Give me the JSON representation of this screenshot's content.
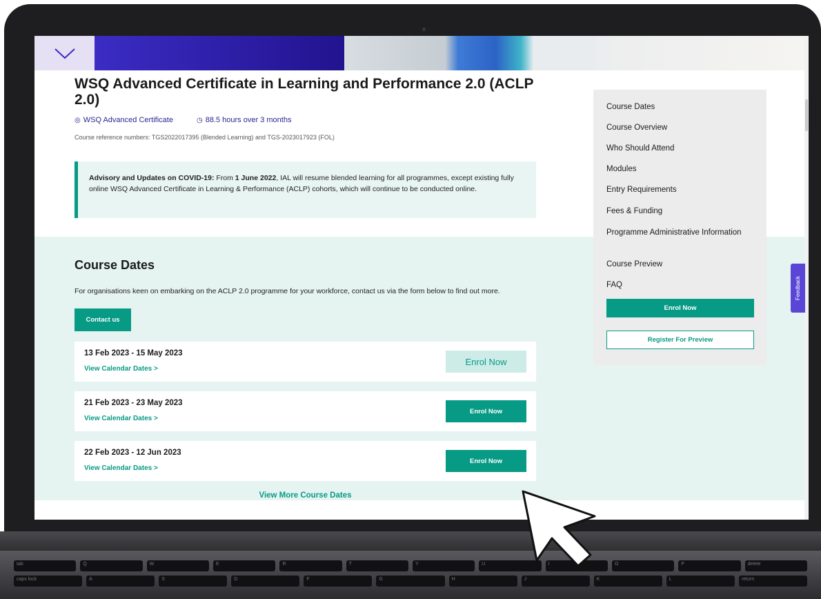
{
  "page": {
    "title": "WSQ Advanced Certificate in Learning and Performance 2.0 (ACLP 2.0)",
    "certificate_type": "WSQ Advanced Certificate",
    "duration": "88.5 hours over 3 months",
    "reference_numbers": "Course reference numbers: TGS2022017395 (Blended Learning) and TGS-2023017923 (FOL)"
  },
  "advisory": {
    "heading": "Advisory and Updates on COVID-19:",
    "text_a": " From ",
    "date": "1 June 2022",
    "text_b": ", IAL will resume blended learning for all programmes, except existing fully online WSQ Advanced Certificate in Learning & Performance (ACLP) cohorts, which will continue to be conducted online."
  },
  "course_dates": {
    "heading": "Course Dates",
    "intro": "For organisations keen on embarking on the ACLP 2.0 programme for your workforce, contact us via the form below to find out more.",
    "contact_label": "Contact us",
    "items": [
      {
        "range": "13 Feb 2023 - 15 May 2023",
        "link": "View Calendar Dates >",
        "button": "Enrol Now"
      },
      {
        "range": "21 Feb 2023 - 23 May 2023",
        "link": "View Calendar Dates >",
        "button": "Enrol Now"
      },
      {
        "range": "22 Feb 2023 - 12 Jun 2023",
        "link": "View Calendar Dates >",
        "button": "Enrol Now"
      }
    ],
    "more_label": "View More Course Dates"
  },
  "sidebar": {
    "items": [
      "Course Dates",
      "Course Overview",
      "Who Should Attend",
      "Modules",
      "Entry Requirements",
      "Fees & Funding",
      "Programme Administrative Information",
      "Course Preview",
      "FAQ"
    ],
    "enrol_label": "Enrol Now",
    "preview_label": "Register For Preview"
  },
  "feedback": {
    "label": "Feedback"
  },
  "keyboard": {
    "row1": [
      "tab",
      "Q",
      "W",
      "E",
      "R",
      "T",
      "Y",
      "U",
      "I",
      "O",
      "P",
      "delete"
    ],
    "row2": [
      "caps lock",
      "A",
      "S",
      "D",
      "F",
      "G",
      "H",
      "J",
      "K",
      "L",
      "return"
    ]
  },
  "colors": {
    "accent": "#079a85",
    "brand_purple": "#2b2790",
    "band_bg": "#e5f4f1",
    "sidebar_bg": "#ececec",
    "feedback_bg": "#5946d6"
  }
}
